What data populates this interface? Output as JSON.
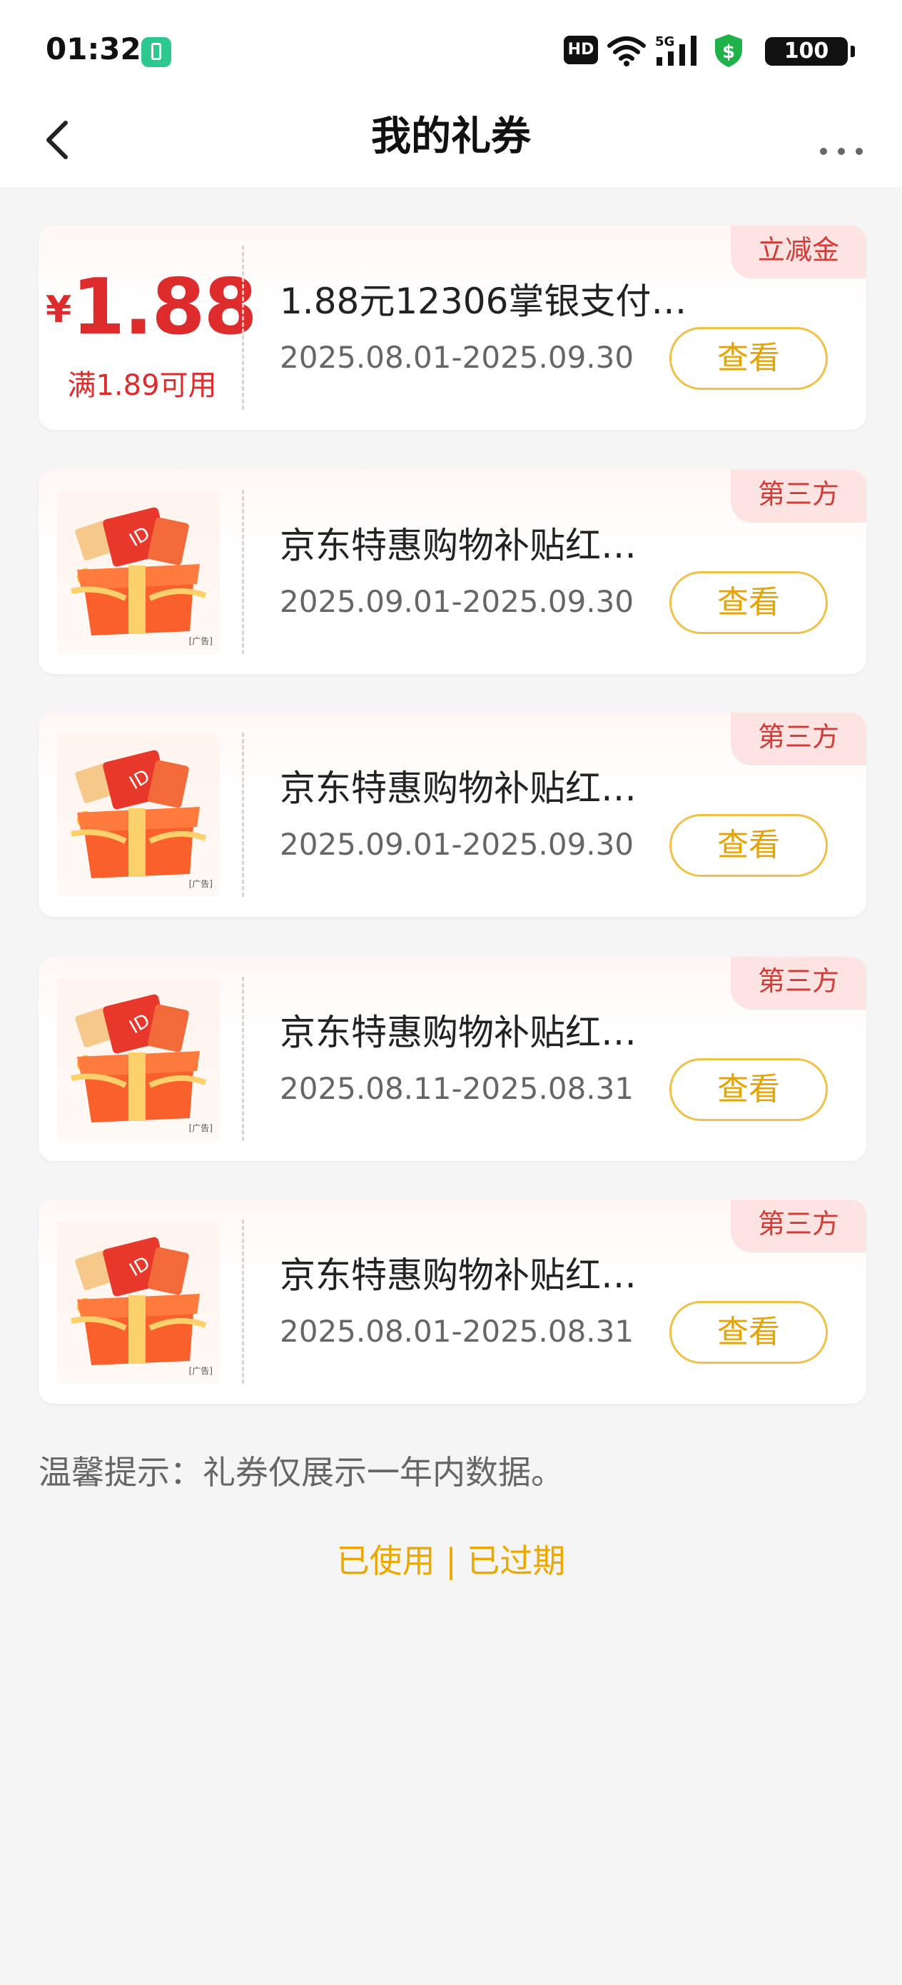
{
  "status_bar": {
    "time": "01:32",
    "hd_label": "HD",
    "network": "5G",
    "battery": "100",
    "icons": [
      "battery-saver-icon",
      "hd-icon",
      "wifi-icon",
      "signal-5g-icon",
      "security-shield-icon",
      "battery-icon"
    ]
  },
  "nav": {
    "title": "我的礼券",
    "back_icon": "chevron-left-icon",
    "more_icon": "more-dots-icon"
  },
  "coupons": [
    {
      "tag": "立减金",
      "amount_symbol": "¥",
      "amount": "1.88",
      "condition": "满1.89可用",
      "title": "1.88元12306掌银支付…",
      "date": "2025.08.01-2025.09.30",
      "button": "查看"
    },
    {
      "tag": "第三方",
      "thumb": "gift-box-icon",
      "ad_mark": "[广告]",
      "title": "京东特惠购物补贴红…",
      "date": "2025.09.01-2025.09.30",
      "button": "查看"
    },
    {
      "tag": "第三方",
      "thumb": "gift-box-icon",
      "ad_mark": "[广告]",
      "title": "京东特惠购物补贴红…",
      "date": "2025.09.01-2025.09.30",
      "button": "查看"
    },
    {
      "tag": "第三方",
      "thumb": "gift-box-icon",
      "ad_mark": "[广告]",
      "title": "京东特惠购物补贴红…",
      "date": "2025.08.11-2025.08.31",
      "button": "查看"
    },
    {
      "tag": "第三方",
      "thumb": "gift-box-icon",
      "ad_mark": "[广告]",
      "title": "京东特惠购物补贴红…",
      "date": "2025.08.01-2025.08.31",
      "button": "查看"
    }
  ],
  "tip": "温馨提示：礼券仅展示一年内数据。",
  "history": {
    "used": "已使用",
    "separator": "|",
    "expired": "已过期"
  },
  "colors": {
    "accent_red": "#de2b2b",
    "button_gold": "#e8a300",
    "tag_bg": "#fde3e1",
    "page_bg": "#f5f5f5"
  }
}
